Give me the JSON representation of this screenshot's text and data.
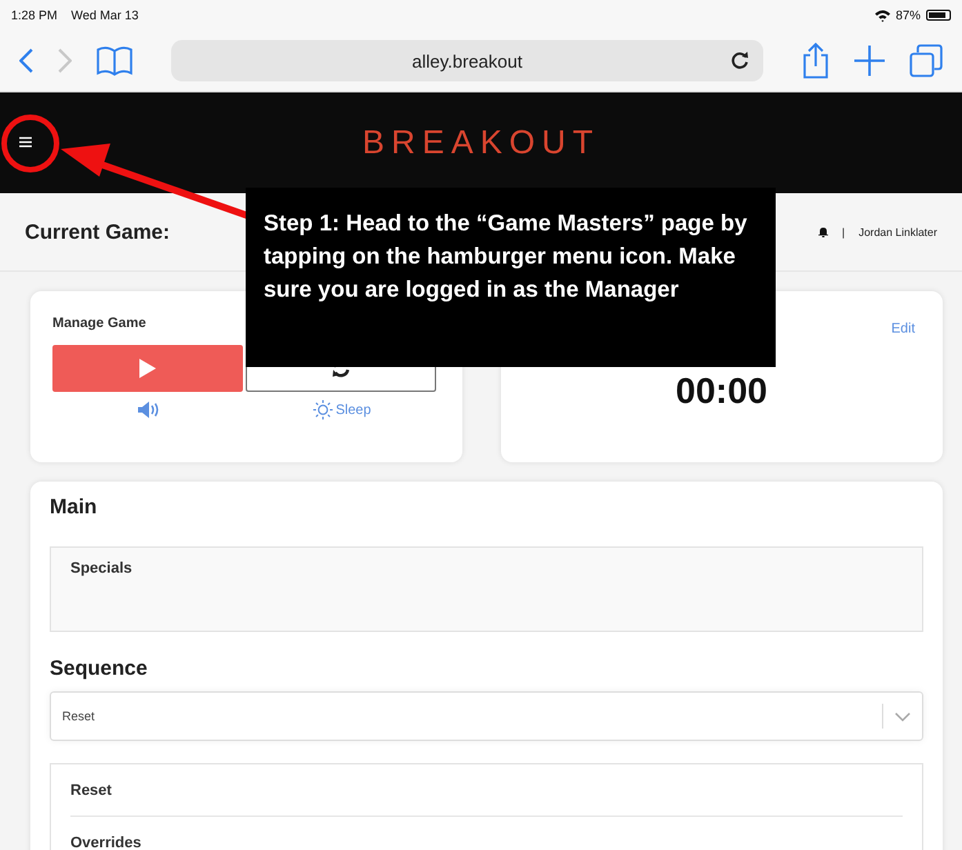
{
  "status_bar": {
    "time": "1:28 PM",
    "date": "Wed Mar 13",
    "battery": "87%"
  },
  "browser": {
    "url": "alley.breakout"
  },
  "header": {
    "logo": "BREAKOUT"
  },
  "game_bar": {
    "label": "Current Game:",
    "separator": "|",
    "user": "Jordan Linklater"
  },
  "manage_card": {
    "title": "Manage Game",
    "sleep_label": "Sleep"
  },
  "timer_card": {
    "edit": "Edit",
    "time": "00:00"
  },
  "main": {
    "title": "Main",
    "specials": "Specials",
    "sequence_title": "Sequence",
    "sequence_value": "Reset",
    "items": [
      {
        "label": "Reset"
      },
      {
        "label": "Overrides"
      }
    ]
  },
  "annotation": {
    "text": "Step 1: Head to the “Game Masters” page by tapping on the hamburger menu icon. Make sure you are logged in as the Manager"
  }
}
